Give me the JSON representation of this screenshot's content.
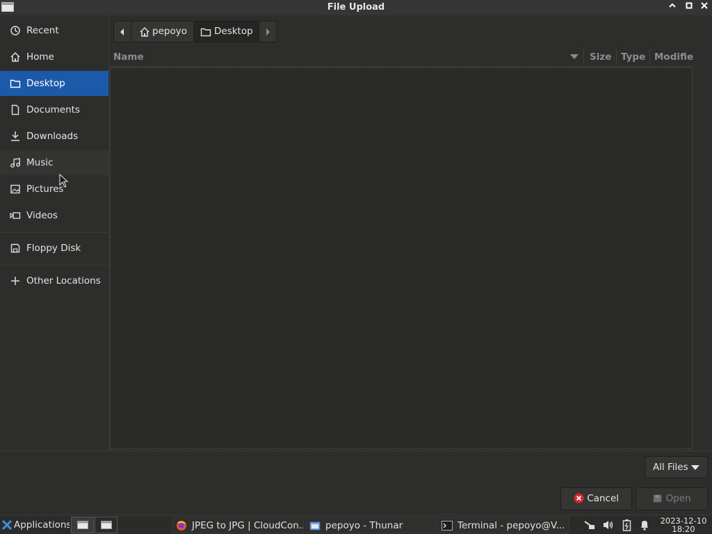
{
  "window": {
    "title": "File Upload"
  },
  "sidebar": {
    "items": [
      {
        "label": "Recent",
        "icon": "clock-icon"
      },
      {
        "label": "Home",
        "icon": "home-icon"
      },
      {
        "label": "Desktop",
        "icon": "folder-icon",
        "active": true
      },
      {
        "label": "Documents",
        "icon": "document-icon"
      },
      {
        "label": "Downloads",
        "icon": "download-icon"
      },
      {
        "label": "Music",
        "icon": "music-icon"
      },
      {
        "label": "Pictures",
        "icon": "picture-icon"
      },
      {
        "label": "Videos",
        "icon": "video-icon"
      },
      {
        "label": "Floppy Disk",
        "icon": "floppy-icon"
      },
      {
        "label": "Other Locations",
        "icon": "plus-icon"
      }
    ]
  },
  "pathbar": {
    "crumbs": [
      "pepoyo",
      "Desktop"
    ]
  },
  "filelist": {
    "columns": {
      "name": "Name",
      "size": "Size",
      "type": "Type",
      "modified": "Modifie"
    }
  },
  "filter": {
    "label": "All Files"
  },
  "buttons": {
    "cancel": "Cancel",
    "open": "Open"
  },
  "taskbar": {
    "applications": "Applications",
    "tasks": [
      "JPEG to JPG | CloudCon...",
      "pepoyo - Thunar",
      "Terminal - pepoyo@V..."
    ],
    "date": "2023-12-10",
    "time": "18:20"
  },
  "colors": {
    "accent": "#1b5aa8",
    "cancel_icon": "#d9262c"
  }
}
